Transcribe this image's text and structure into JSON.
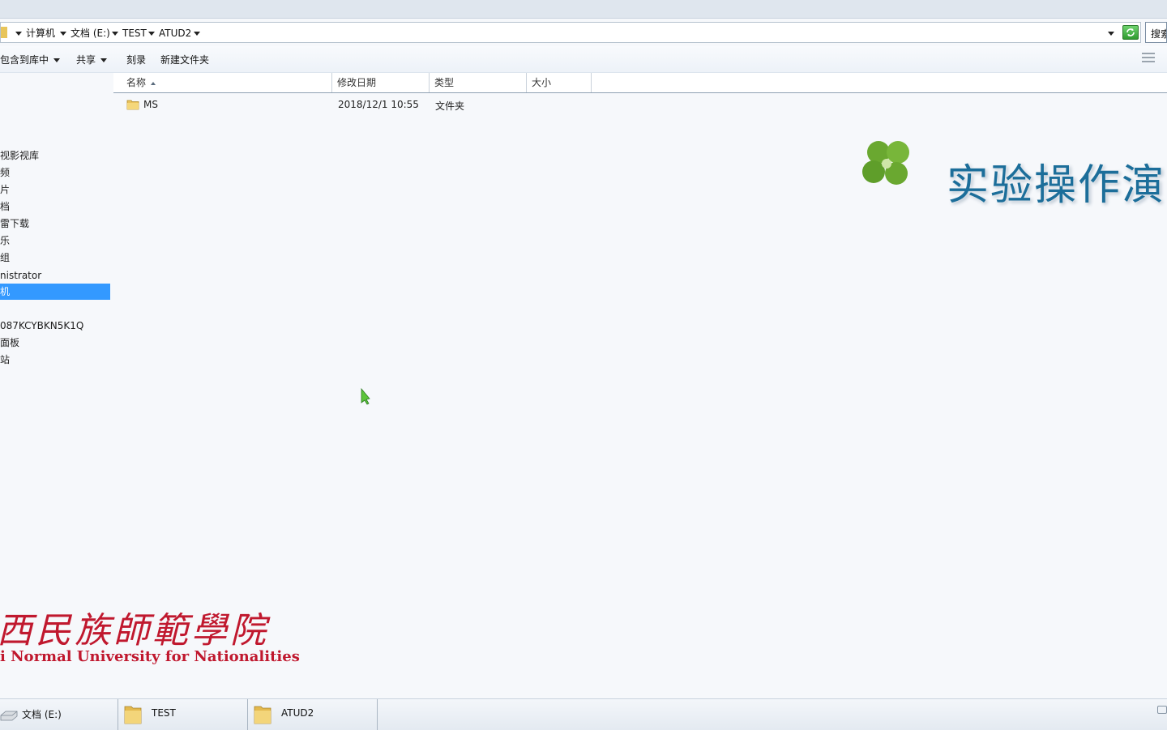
{
  "address": {
    "breadcrumbs": [
      "计算机",
      "文档 (E:)",
      "TEST",
      "ATUD2"
    ],
    "search_label": "搜索"
  },
  "toolbar": {
    "include_library": "包含到库中",
    "share": "共享",
    "burn": "刻录",
    "new_folder": "新建文件夹"
  },
  "nav": {
    "items": [
      "视影视库",
      "频",
      "片",
      "档",
      "雷下载",
      "乐",
      "组",
      "nistrator",
      "机",
      "087KCYBKN5K1Q",
      "面板",
      "站"
    ],
    "selected_index": 8
  },
  "columns": {
    "name": "名称",
    "modified": "修改日期",
    "type": "类型",
    "size": "大小"
  },
  "files": [
    {
      "name": "MS",
      "modified": "2018/12/1 10:55",
      "type": "文件夹",
      "size": ""
    }
  ],
  "overlay": {
    "demo_text": "实验操作演",
    "university_cn": "西民族師範學院",
    "university_en": "i Normal University for Nationalities"
  },
  "statusbar": {
    "items": [
      "文档 (E:)",
      "TEST",
      "ATUD2"
    ]
  },
  "colors": {
    "selection": "#3399ff",
    "watermark_red": "#c0182e",
    "demo_blue": "#1c6e9a"
  }
}
